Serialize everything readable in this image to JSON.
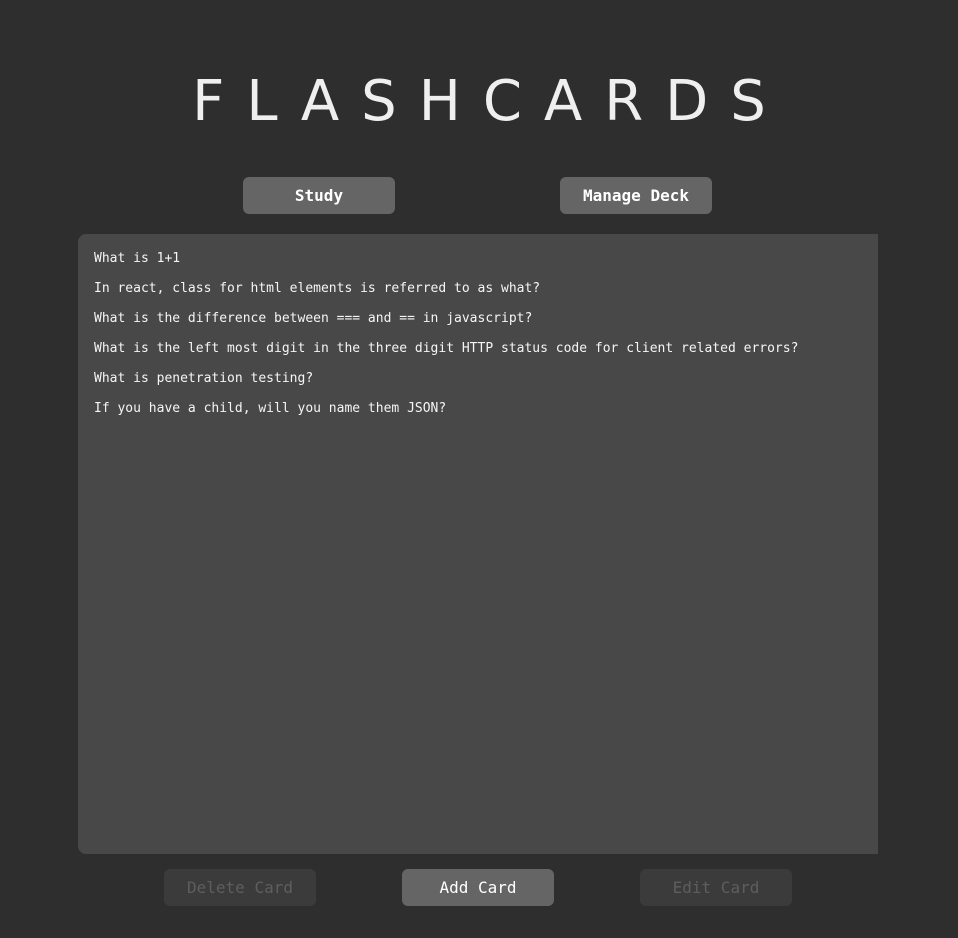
{
  "app": {
    "title": "FLASHCARDS"
  },
  "nav": {
    "study_label": "Study",
    "manage_label": "Manage Deck"
  },
  "cards": [
    {
      "question": "What is 1+1"
    },
    {
      "question": "In react, class for html elements is referred to as what?"
    },
    {
      "question": "What is the difference between === and == in javascript?"
    },
    {
      "question": "What is the left most digit in the three digit HTTP status code for client related errors?"
    },
    {
      "question": "What is penetration testing?"
    },
    {
      "question": "If you have a child, will you name them JSON?"
    }
  ],
  "actions": {
    "delete_label": "Delete Card",
    "add_label": "Add Card",
    "edit_label": "Edit Card"
  },
  "colors": {
    "background": "#2e2e2e",
    "panel": "#484848",
    "button": "#656565",
    "button_disabled": "#3b3b3b"
  }
}
